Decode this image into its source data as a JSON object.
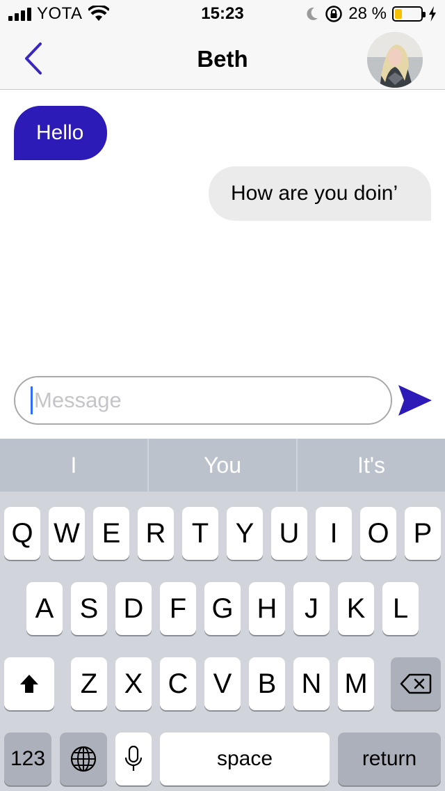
{
  "status_bar": {
    "carrier": "YOTA",
    "time": "15:23",
    "battery_percent": "28 %",
    "battery_level": 0.28,
    "icons": [
      "signal-bars-icon",
      "wifi-icon",
      "moon-icon",
      "rotation-lock-icon",
      "battery-icon",
      "charging-bolt-icon"
    ]
  },
  "nav": {
    "title": "Beth",
    "back_icon": "chevron-left-icon",
    "avatar": "contact-avatar"
  },
  "messages": [
    {
      "direction": "incoming",
      "text": "Hello"
    },
    {
      "direction": "outgoing",
      "text": "How are you doin’"
    }
  ],
  "composer": {
    "placeholder": "Message",
    "send_icon": "send-arrow-icon"
  },
  "predictions": [
    "I",
    "You",
    "It's"
  ],
  "keyboard": {
    "row1": [
      "Q",
      "W",
      "E",
      "R",
      "T",
      "Y",
      "U",
      "I",
      "O",
      "P"
    ],
    "row2": [
      "A",
      "S",
      "D",
      "F",
      "G",
      "H",
      "J",
      "K",
      "L"
    ],
    "row3": [
      "Z",
      "X",
      "C",
      "V",
      "B",
      "N",
      "M"
    ],
    "numbers_label": "123",
    "space_label": "space",
    "return_label": "return"
  },
  "colors": {
    "accent": "#2c1bb6",
    "incoming_bubble": "#2c1bb6",
    "outgoing_bubble": "#ebebeb",
    "battery_fill": "#f6c200",
    "keyboard_bg": "#d1d4da",
    "predict_bg": "#bcc2cc"
  }
}
